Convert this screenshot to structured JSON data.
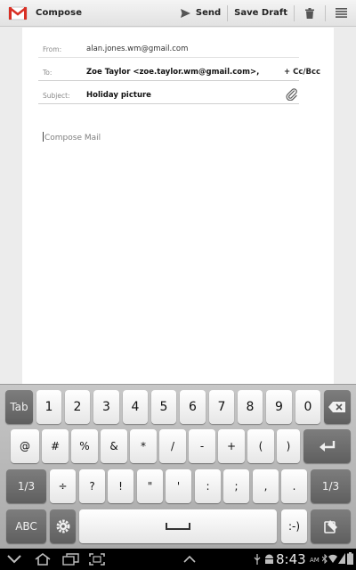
{
  "actionbar": {
    "title": "Compose",
    "send_label": "Send",
    "save_draft_label": "Save Draft",
    "icons": [
      "gmail-icon",
      "send-icon",
      "trash-icon",
      "menu-icon"
    ]
  },
  "compose": {
    "from_label": "From:",
    "from_value": "alan.jones.wm@gmail.com",
    "to_label": "To:",
    "to_value": "Zoe Taylor <zoe.taylor.wm@gmail.com>,",
    "cc_bcc_label": "+ Cc/Bcc",
    "subject_label": "Subject:",
    "subject_value": "Holiday picture",
    "body_placeholder": "Compose Mail"
  },
  "keyboard": {
    "row1": [
      "Tab",
      "1",
      "2",
      "3",
      "4",
      "5",
      "6",
      "7",
      "8",
      "9",
      "0"
    ],
    "row2": [
      "@",
      "#",
      "%",
      "&",
      "*",
      "/",
      "-",
      "+",
      "(",
      ")"
    ],
    "row3": [
      "1/3",
      "÷",
      "?",
      "!",
      "\"",
      "'",
      ":",
      ";",
      ",",
      ".",
      "1/3"
    ],
    "row4_abc": "ABC",
    "row4_smiley": ":-)",
    "icons": [
      "backspace-icon",
      "enter-icon",
      "settings-icon",
      "space-icon",
      "clipboard-icon"
    ]
  },
  "statusbar": {
    "time": "8:43",
    "ampm": "AM",
    "icons": [
      "back-icon",
      "home-icon",
      "recent-apps-icon",
      "screenshot-icon",
      "up-chevron-icon",
      "usb-icon",
      "android-icon",
      "bluetooth-icon",
      "wifi-icon",
      "signal-icon",
      "battery-icon"
    ]
  }
}
